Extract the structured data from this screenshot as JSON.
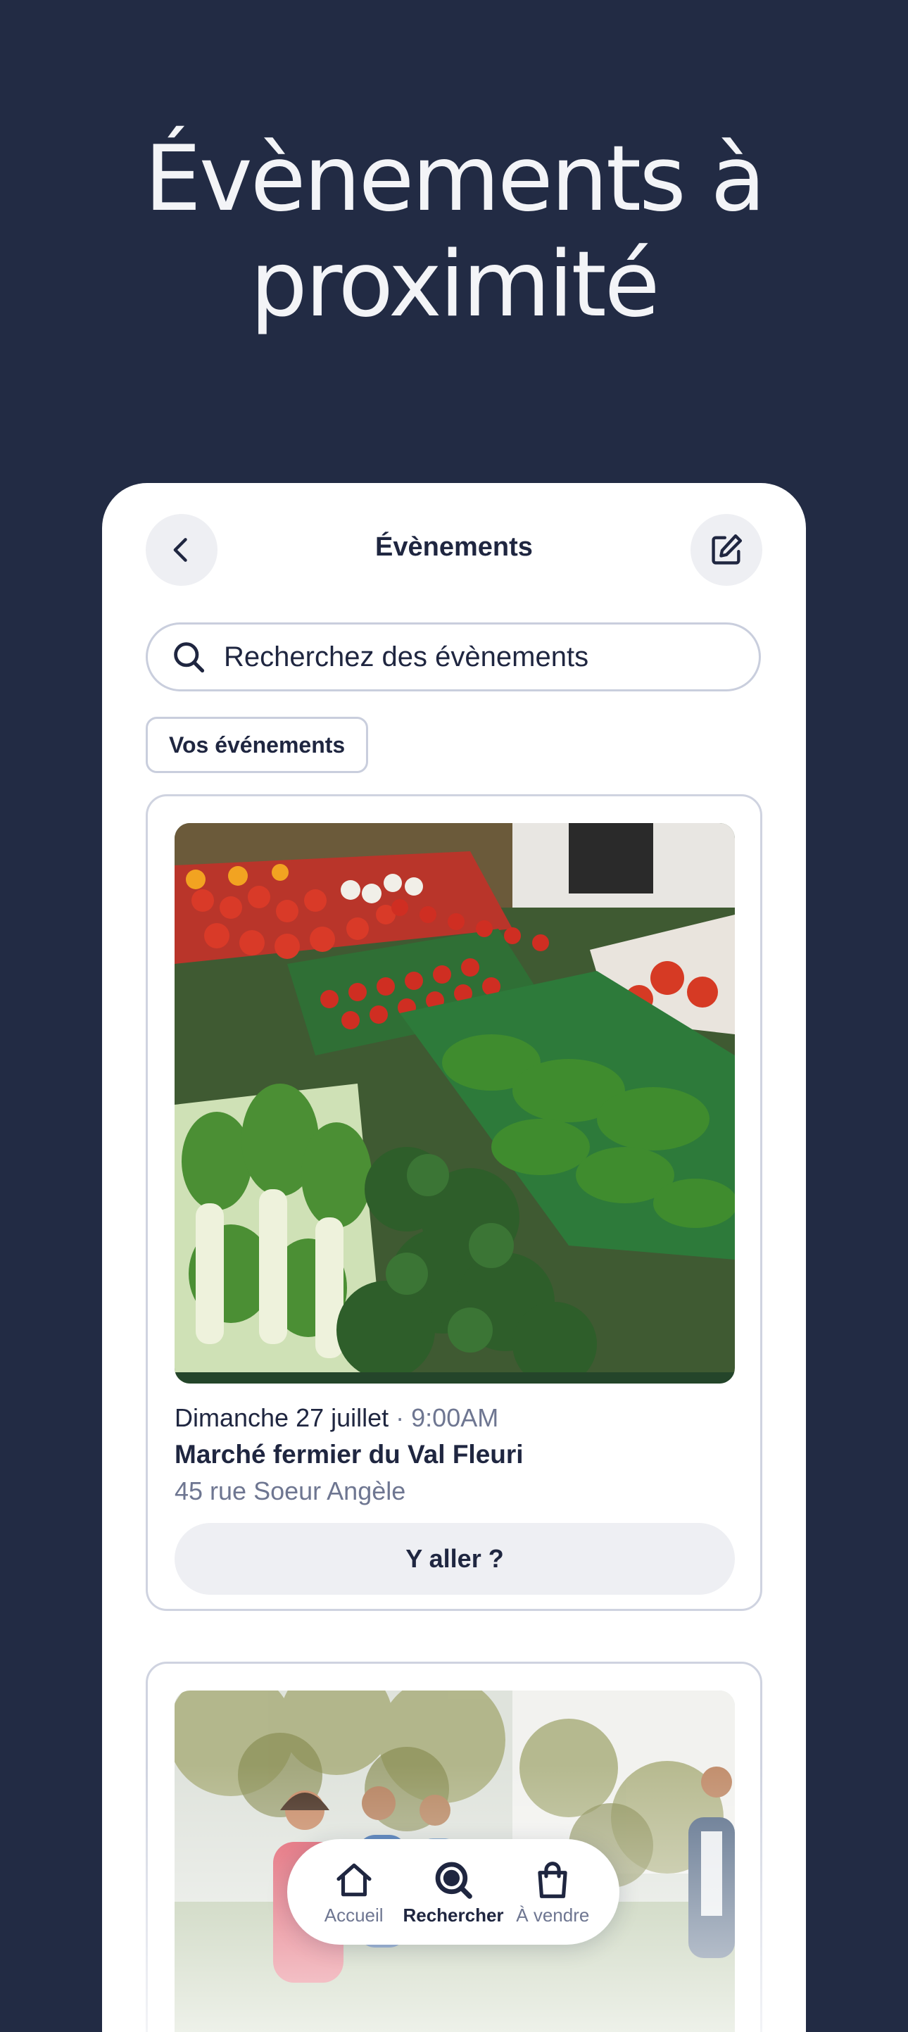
{
  "headline": {
    "line1": "Évènements à",
    "line2": "proximité"
  },
  "header": {
    "title": "Évènements",
    "back_icon": "chevron-left-icon",
    "edit_icon": "edit-icon"
  },
  "search": {
    "placeholder": "Recherchez des évènements",
    "icon": "search-icon"
  },
  "filter_chip": {
    "label": "Vos événements"
  },
  "events": [
    {
      "image": "vegetable-market-photo",
      "date": "Dimanche 27 juillet",
      "separator": " · ",
      "time": "9:00AM",
      "name": "Marché fermier du Val Fleuri",
      "address": "45 rue Soeur Angèle",
      "cta": "Y aller ?"
    },
    {
      "image": "runners-photo"
    }
  ],
  "tabbar": {
    "items": [
      {
        "label": "Accueil",
        "icon": "home-icon",
        "active": false
      },
      {
        "label": "Rechercher",
        "icon": "search-icon",
        "active": true
      },
      {
        "label": "À vendre",
        "icon": "shopping-bag-icon",
        "active": false
      }
    ]
  },
  "colors": {
    "background": "#222b44",
    "text": "#1f2640",
    "muted": "#6e7691",
    "surface": "#eeeff3"
  }
}
